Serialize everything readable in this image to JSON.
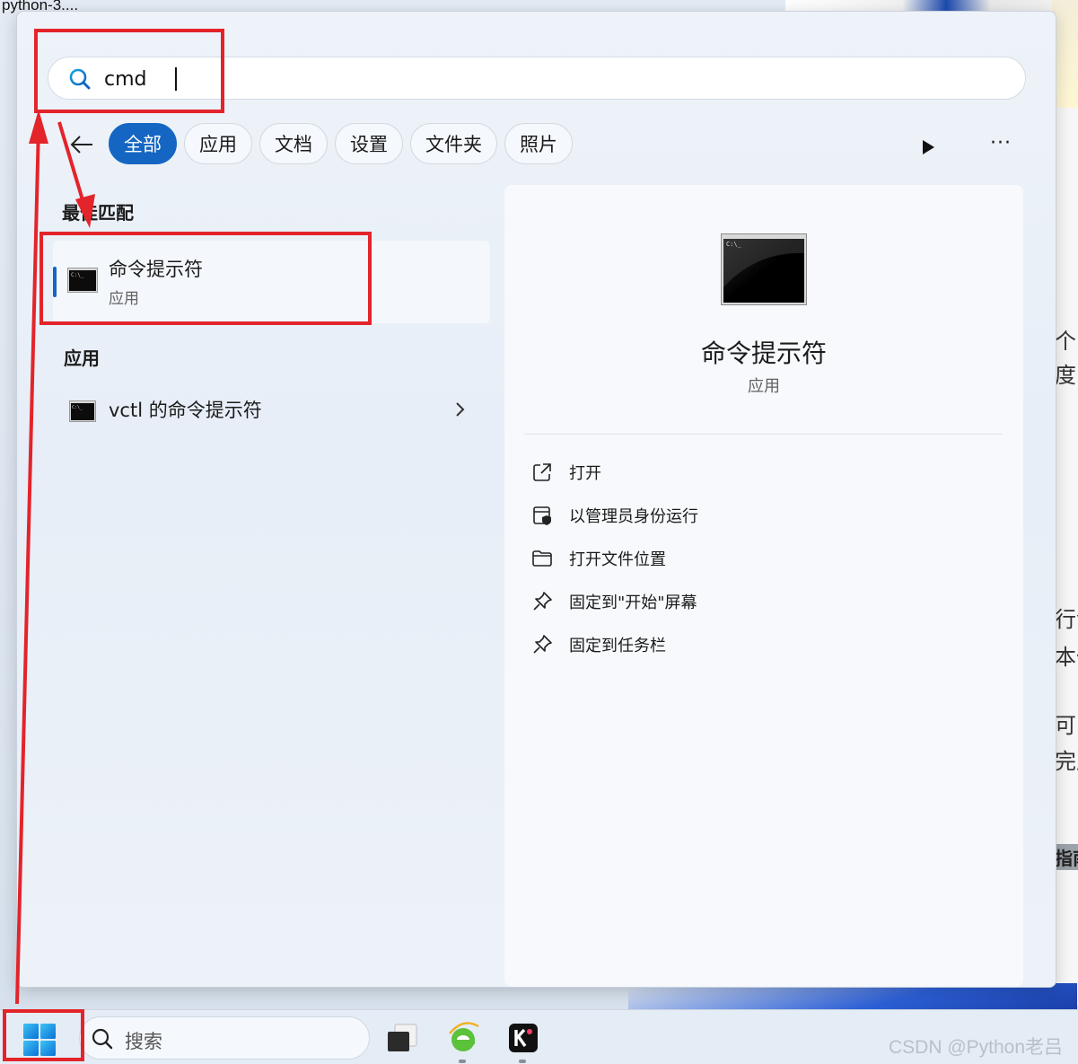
{
  "background": {
    "window_title": "python-3....",
    "right_panel_fragments": [
      "个",
      "度阳",
      "行命",
      "本信",
      "可问",
      "完成",
      "指南"
    ]
  },
  "search": {
    "query": "cmd"
  },
  "filters": [
    {
      "label": "全部",
      "active": true
    },
    {
      "label": "应用",
      "active": false
    },
    {
      "label": "文档",
      "active": false
    },
    {
      "label": "设置",
      "active": false
    },
    {
      "label": "文件夹",
      "active": false
    },
    {
      "label": "照片",
      "active": false
    }
  ],
  "more_label": "···",
  "best_match": {
    "section_title": "最佳匹配",
    "name": "命令提示符",
    "type": "应用"
  },
  "apps": {
    "section_title": "应用",
    "items": [
      {
        "name": "vctl 的命令提示符"
      }
    ]
  },
  "details": {
    "title": "命令提示符",
    "subtitle": "应用",
    "actions": [
      {
        "label": "打开",
        "icon": "open-external-icon"
      },
      {
        "label": "以管理员身份运行",
        "icon": "run-as-admin-icon"
      },
      {
        "label": "打开文件位置",
        "icon": "folder-icon"
      },
      {
        "label": "固定到\"开始\"屏幕",
        "icon": "pin-icon"
      },
      {
        "label": "固定到任务栏",
        "icon": "pin-icon"
      }
    ]
  },
  "taskbar": {
    "search_label": "搜索",
    "apps": [
      "task-view-app",
      "ie-browser-app",
      "kingsoft-app"
    ]
  },
  "watermark": "CSDN @Python老吕",
  "colors": {
    "accent": "#1466c2",
    "annotation": "#e3242b"
  }
}
